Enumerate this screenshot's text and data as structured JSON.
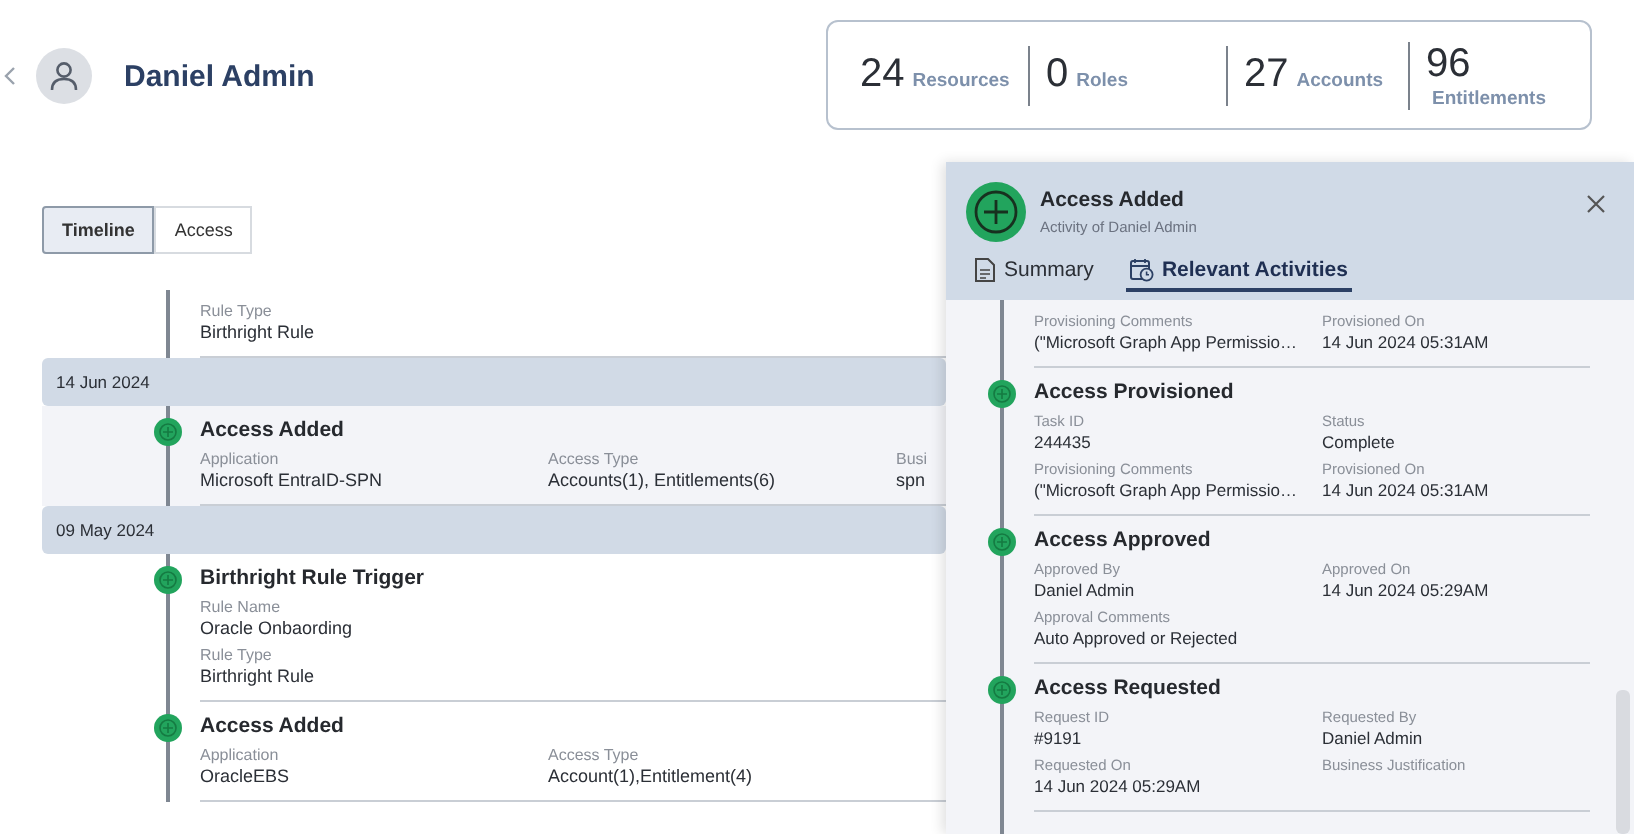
{
  "header": {
    "name": "Daniel Admin"
  },
  "stats": [
    {
      "value": "24",
      "label": "Resources"
    },
    {
      "value": "0",
      "label": "Roles"
    },
    {
      "value": "27",
      "label": "Accounts"
    },
    {
      "value": "96",
      "label": "Entitlements"
    }
  ],
  "tabs": [
    {
      "label": "Timeline",
      "selected": true
    },
    {
      "label": "Access",
      "selected": false
    }
  ],
  "timeline": [
    {
      "kind": "event",
      "selected": false,
      "rows": [
        [
          {
            "label": "Rule Type",
            "value": "Birthright Rule"
          }
        ]
      ]
    },
    {
      "kind": "date",
      "label": "14 Jun 2024"
    },
    {
      "kind": "event",
      "title": "Access Added",
      "selected": true,
      "rows": [
        [
          {
            "label": "Application",
            "value": "Microsoft EntraID-SPN"
          },
          {
            "label": "Access Type",
            "value": "Accounts(1), Entitlements(6)"
          },
          {
            "label": "Busi",
            "value": "spn"
          }
        ]
      ]
    },
    {
      "kind": "date",
      "label": "09 May 2024"
    },
    {
      "kind": "event",
      "title": "Birthright Rule Trigger",
      "selected": false,
      "rows": [
        [
          {
            "label": "Rule Name",
            "value": "Oracle Onbaording"
          }
        ],
        [
          {
            "label": "Rule Type",
            "value": "Birthright Rule"
          }
        ]
      ]
    },
    {
      "kind": "event",
      "title": "Access Added",
      "selected": false,
      "rows": [
        [
          {
            "label": "Application",
            "value": "OracleEBS"
          },
          {
            "label": "Access Type",
            "value": "Account(1),Entitlement(4)"
          }
        ]
      ]
    }
  ],
  "panel": {
    "title": "Access Added",
    "subtitle": "Activity of Daniel Admin",
    "tabs": [
      {
        "label": "Summary",
        "kind": "document",
        "selected": false
      },
      {
        "label": "Relevant Activities",
        "kind": "history",
        "selected": true
      }
    ],
    "events": [
      {
        "rows": [
          [
            {
              "label": "Provisioning Comments",
              "value": "(\"Microsoft Graph App Permissio…"
            },
            {
              "label": "Provisioned On",
              "value": "14 Jun 2024 05:31AM"
            }
          ]
        ]
      },
      {
        "title": "Access Provisioned",
        "rows": [
          [
            {
              "label": "Task ID",
              "value": "244435"
            },
            {
              "label": "Status",
              "value": "Complete"
            }
          ],
          [
            {
              "label": "Provisioning Comments",
              "value": "(\"Microsoft Graph App Permissio…"
            },
            {
              "label": "Provisioned On",
              "value": "14 Jun 2024 05:31AM"
            }
          ]
        ]
      },
      {
        "title": "Access Approved",
        "rows": [
          [
            {
              "label": "Approved By",
              "value": "Daniel Admin"
            },
            {
              "label": "Approved On",
              "value": "14 Jun 2024 05:29AM"
            }
          ],
          [
            {
              "label": "Approval Comments",
              "value": "Auto Approved or Rejected"
            }
          ]
        ]
      },
      {
        "title": "Access Requested",
        "rows": [
          [
            {
              "label": "Request ID",
              "value": "#9191"
            },
            {
              "label": "Requested By",
              "value": "Daniel Admin"
            }
          ],
          [
            {
              "label": "Requested On",
              "value": "14 Jun 2024 05:29AM"
            },
            {
              "label": "Business Justification"
            }
          ]
        ]
      }
    ]
  }
}
